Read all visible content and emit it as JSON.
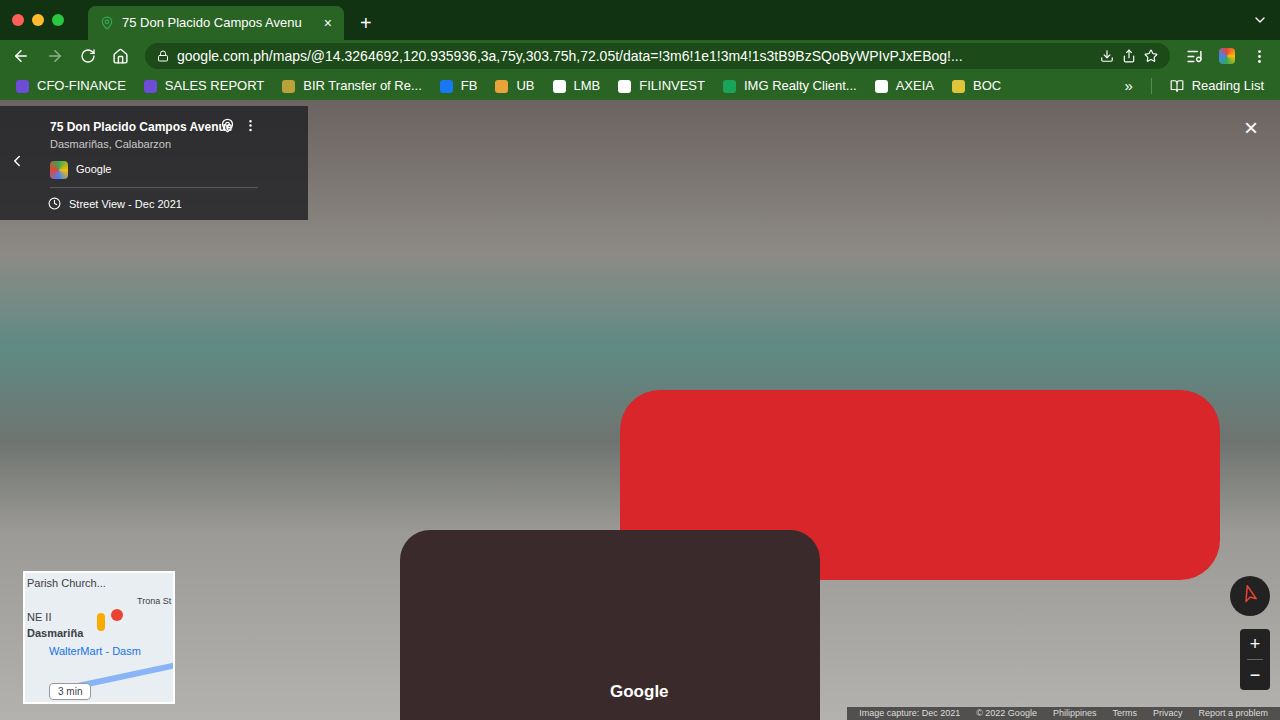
{
  "browser": {
    "tab": {
      "title": "75 Don Placido Campos Avenu",
      "close": "×"
    },
    "new_tab": "+",
    "url": "google.com.ph/maps/@14.3264692,120.935936,3a,75y,303.75h,72.05t/data=!3m6!1e1!3m4!1s3tB9BzSQoByWPIvPJxEBog!...",
    "bookmarks": [
      "CFO-FINANCE",
      "SALES REPORT",
      "BIR Transfer of Re...",
      "FB",
      "UB",
      "LMB",
      "FILINVEST",
      "IMG Realty Client...",
      "AXEIA",
      "BOC"
    ],
    "more_bookmarks": "»",
    "reading_list": "Reading List"
  },
  "info_card": {
    "title": "75 Don Placido Campos Avenue",
    "subtitle": "Dasmariñas, Calabarzon",
    "source": "Google",
    "date": "Street View - Dec 2021"
  },
  "close": "×",
  "minimap": {
    "labels": [
      "Parish Church...",
      "NE II",
      "Dasmariña",
      "WalterMart - Dasm",
      "Trona St"
    ],
    "route_time": "3 min"
  },
  "zoom": {
    "in": "+",
    "out": "−"
  },
  "watermark": "Google",
  "footer": [
    "Image capture: Dec 2021",
    "© 2022 Google",
    "Philippines",
    "Terms",
    "Privacy",
    "Report a problem"
  ]
}
